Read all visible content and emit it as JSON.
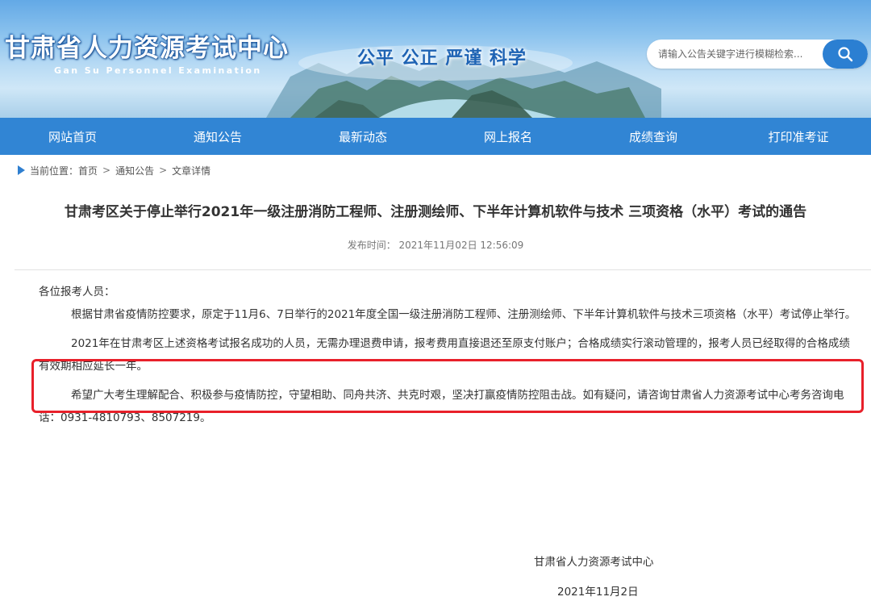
{
  "header": {
    "site_title": "甘肃省人力资源考试中心",
    "site_subtitle": "Gan Su Personnel Examination",
    "slogan": "公平 公正 严谨 科学",
    "search": {
      "placeholder": "请输入公告关键字进行模糊检索..."
    }
  },
  "nav": {
    "items": [
      {
        "label": "网站首页"
      },
      {
        "label": "通知公告"
      },
      {
        "label": "最新动态"
      },
      {
        "label": "网上报名"
      },
      {
        "label": "成绩查询"
      },
      {
        "label": "打印准考证"
      }
    ]
  },
  "breadcrumb": {
    "prefix": "当前位置：",
    "items": [
      "首页",
      "通知公告",
      "文章详情"
    ],
    "separator": ">"
  },
  "article": {
    "title": "甘肃考区关于停止举行2021年一级注册消防工程师、注册测绘师、下半年计算机软件与技术 三项资格（水平）考试的通告",
    "publish_time": "发布时间： 2021年11月02日 12:56:09",
    "greeting": "各位报考人员：",
    "paragraphs": [
      "根据甘肃省疫情防控要求，原定于11月6、7日举行的2021年度全国一级注册消防工程师、注册测绘师、下半年计算机软件与技术三项资格（水平）考试停止举行。",
      "2021年在甘肃考区上述资格考试报名成功的人员，无需办理退费申请，报考费用直接退还至原支付账户；合格成绩实行滚动管理的，报考人员已经取得的合格成绩有效期相应延长一年。",
      "希望广大考生理解配合、积极参与疫情防控，守望相助、同舟共济、共克时艰，坚决打赢疫情防控阻击战。如有疑问，请咨询甘肃省人力资源考试中心考务咨询电话：0931-4810793、8507219。"
    ],
    "signature_org": "甘肃省人力资源考试中心",
    "signature_date": "2021年11月2日"
  },
  "colors": {
    "nav_background": "#3185d4",
    "accent_blue": "#2b7fd2",
    "highlight_border": "#e8202a"
  }
}
